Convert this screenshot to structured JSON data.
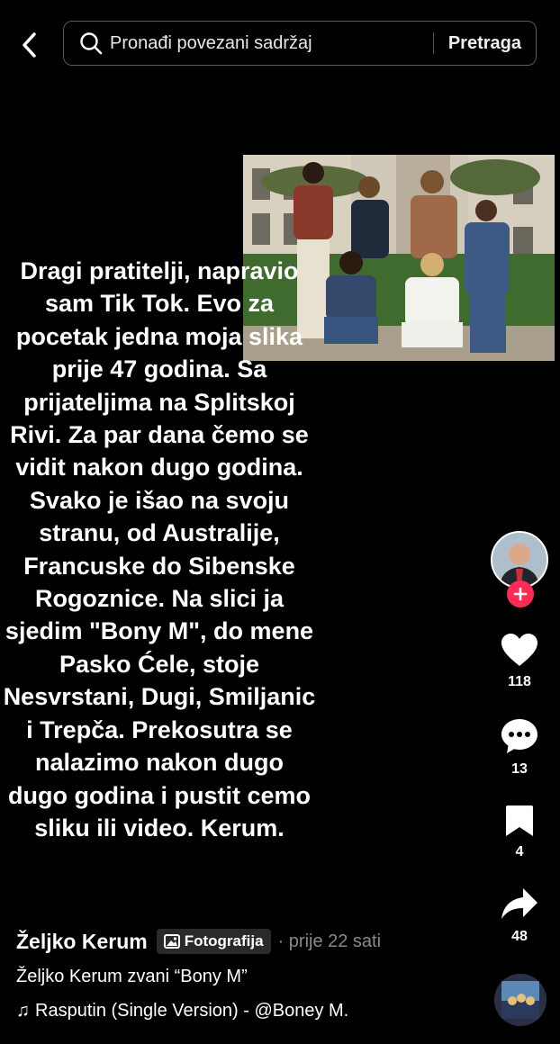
{
  "search": {
    "placeholder": "Pronađi povezani sadržaj",
    "button": "Pretraga"
  },
  "post": {
    "caption": "Dragi pratitelji, napravio\nsam Tik Tok. Evo za\npocetak jedna moja slika\nprije 47 godina. Sa\nprijateljima na Splitskoj\nRivi. Za par dana čemo se\nvidit nakon dugo godina.\nSvako je išao na svoju\nstranu, od Australije,\nFrancuske do Sibenske\nRogoznice. Na slici ja\nsjedim \"Bony M\", do mene\nPasko Ćele, stoje\nNesvrstani, Dugi, Smiljanic\ni Trepča. Prekosutra se\nnalazimo nakon dugo\ndugo godina i pustit cemo\nsliku ili video. Kerum.",
    "author": "Željko Kerum",
    "type_badge": "Fotografija",
    "time": "· prije 22 sati",
    "description": "Željko Kerum zvani “Bony M”",
    "music": "Rasputin (Single Version) - @Boney M."
  },
  "actions": {
    "likes": "118",
    "comments": "13",
    "saves": "4",
    "shares": "48"
  },
  "colors": {
    "background": "#000000",
    "follow_badge": "#fe2c55",
    "muted_text": "#8a8a8a"
  }
}
